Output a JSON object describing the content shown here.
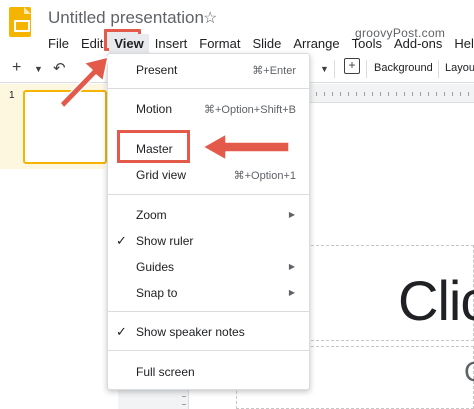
{
  "header": {
    "title": "Untitled presentation",
    "star_icon": "star-outline-icon",
    "watermark": "groovyPost.com"
  },
  "menubar": {
    "items": [
      "File",
      "Edit",
      "View",
      "Insert",
      "Format",
      "Slide",
      "Arrange",
      "Tools",
      "Add-ons",
      "Help"
    ]
  },
  "toolbar": {
    "background_label": "Background",
    "layout_label": "Layou"
  },
  "filmstrip": {
    "slide_number": "1"
  },
  "canvas": {
    "title_text": "Clic",
    "subtitle_text": "C"
  },
  "view_menu": {
    "present": {
      "label": "Present",
      "shortcut": "⌘+Enter"
    },
    "motion": {
      "label": "Motion",
      "shortcut": "⌘+Option+Shift+B"
    },
    "master": {
      "label": "Master"
    },
    "grid_view": {
      "label": "Grid view",
      "shortcut": "⌘+Option+1"
    },
    "zoom": {
      "label": "Zoom"
    },
    "show_ruler": {
      "label": "Show ruler",
      "checked": true
    },
    "guides": {
      "label": "Guides"
    },
    "snap_to": {
      "label": "Snap to"
    },
    "show_speaker_notes": {
      "label": "Show speaker notes",
      "checked": true
    },
    "full_screen": {
      "label": "Full screen"
    }
  },
  "colors": {
    "annotation_red": "#e35a4b",
    "slides_yellow": "#f4b400"
  }
}
